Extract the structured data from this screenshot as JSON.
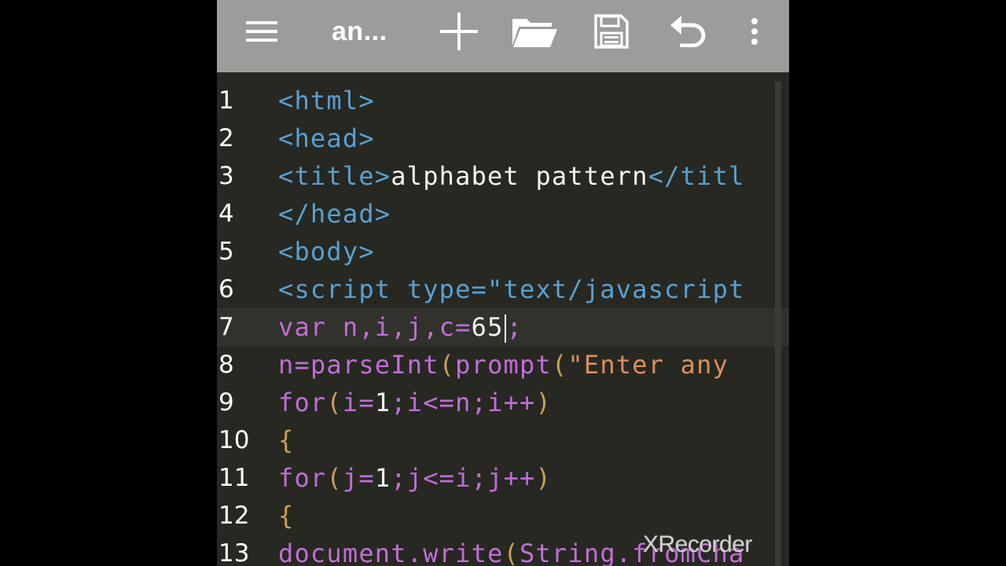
{
  "toolbar": {
    "file_title": "an...",
    "icons": [
      "menu-icon",
      "plus-icon",
      "folder-icon",
      "save-icon",
      "undo-icon",
      "more-vert-icon"
    ]
  },
  "editor": {
    "line_numbers": [
      "1",
      "2",
      "3",
      "4",
      "5",
      "6",
      "7",
      "8",
      "9",
      "10",
      "11",
      "12",
      "13"
    ],
    "lines": [
      [
        "<html>"
      ],
      [
        "<head>"
      ],
      [
        "<title>",
        "alphabet pattern",
        "</titl"
      ],
      [
        "</head>"
      ],
      [
        "<body>"
      ],
      [
        "<script type=\"text/javascript"
      ],
      [
        "var",
        " n",
        ",",
        "i",
        ",",
        "j",
        ",",
        "c",
        "=",
        "65",
        ";"
      ],
      [
        "n",
        "=",
        "parseInt",
        "(",
        "prompt",
        "(",
        "\"Enter any "
      ],
      [
        "for",
        "(",
        "i",
        "=",
        "1",
        ";",
        "i",
        "<=",
        "n",
        ";",
        "i",
        "++",
        ")"
      ],
      [
        "{"
      ],
      [
        "for",
        "(",
        "j",
        "=",
        "1",
        ";",
        "j",
        "<=",
        "i",
        ";",
        "j",
        "++",
        ")"
      ],
      [
        "{"
      ],
      [
        "document",
        ".",
        "write",
        "(",
        "String",
        ".",
        "fromCha"
      ]
    ],
    "current_line": 7
  },
  "colors": {
    "background": "#272822",
    "toolbar": "#9c9d9a",
    "tag": "#59a0d1",
    "keyword": "#c06ed6",
    "string": "#d9905a"
  },
  "watermark": "XRecorder"
}
